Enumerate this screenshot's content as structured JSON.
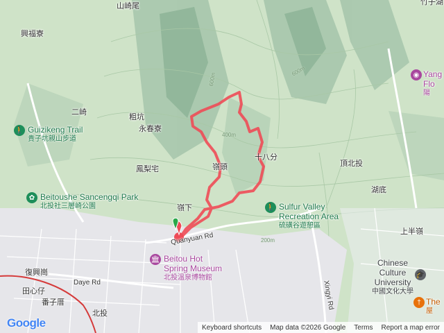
{
  "map": {
    "colors": {
      "terrain": "#cfe3c8",
      "urban": "#e6e6ea",
      "route": "#ee4b57",
      "road": "#ffffff",
      "rail": "#d53a3a"
    }
  },
  "place_labels": {
    "shanqiwei": "山崎尾",
    "xingfuliao": "興福寮",
    "erqi": "二崎",
    "cukeng": "粗坑",
    "yongchunliao": "永春寮",
    "fengliizhai": "鳳梨宅",
    "lingtou": "嶺頭",
    "shibafen": "十八分",
    "lingxia": "嶺下",
    "dingbeitou": "頂北投",
    "hudi": "湖底",
    "shangbanling": "上半嶺",
    "fuxinggang": "復興崗",
    "tianxinzai": "田心仔",
    "fanzicuo": "番子厝",
    "beitou": "北投",
    "zhuzihu": "竹子湖"
  },
  "contours": {
    "c600a": "600m",
    "c600b": "600m",
    "c400": "400m",
    "c200": "200m"
  },
  "roads": {
    "quanyuan": "Quanyuan Rd",
    "daye": "Daye Rd",
    "xingyi": "Xingyi Rd"
  },
  "pois": {
    "guizikeng": {
      "name": "Guizikeng Trail",
      "sub": "貴子坑親山步道",
      "icon": "hiking-icon"
    },
    "beitoushe": {
      "name": "Beitoushe Sancengqi Park",
      "sub": "北投社三層崎公園",
      "icon": "flower-icon"
    },
    "sulfur": {
      "name": "Sulfur Valley",
      "name2": "Recreation Area",
      "sub": "硫磺谷遊憩區",
      "icon": "hiking-icon"
    },
    "museum": {
      "name": "Beitou Hot",
      "name2": "Spring Museum",
      "sub": "北投溫泉博物館",
      "icon": "museum-icon"
    },
    "chinese_culture": {
      "name": "Chinese",
      "name2": "Culture",
      "name3": "University",
      "sub": "中國文化大學",
      "icon": "school-icon"
    },
    "yang": {
      "name": "Yang",
      "name2": "Flo",
      "sub": "陽",
      "icon": "camera-icon"
    },
    "the": {
      "name": "The",
      "sub": "屋",
      "icon": "restaurant-icon"
    }
  },
  "google_logo": "Google",
  "attribution": {
    "shortcuts": "Keyboard shortcuts",
    "data": "Map data ©2026 Google",
    "terms": "Terms",
    "report": "Report a map error"
  }
}
